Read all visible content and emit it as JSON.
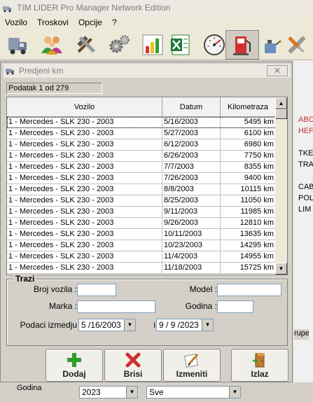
{
  "app": {
    "title": "TIM LIDER Pro Manager Network Edition"
  },
  "menu": [
    "Vozilo",
    "Troskovi",
    "Opcije",
    "?"
  ],
  "toolbar": {
    "icons": [
      "truck-icon",
      "users-icon",
      "tools-icon",
      "gears-icon",
      "bar-chart-icon",
      "excel-icon",
      "speedometer-icon",
      "fuel-icon",
      "oil-can-icon",
      "wrench-screwdriver-icon"
    ]
  },
  "background": {
    "cells": [
      "ABC",
      "HEF",
      "TKE",
      "TRA",
      "CAB",
      "POL",
      "LIM"
    ],
    "grupe_label": "rupe",
    "godina_label": "Godina",
    "godina_value": "2023",
    "sve_value": "Sve"
  },
  "dialog": {
    "title": "Predjeni km",
    "counter": "Podatak 1 od 279",
    "columns": [
      "Vozilo",
      "Datum",
      "Kilometraza"
    ],
    "rows": [
      [
        "1 - Mercedes - SLK 230 - 2003",
        "5/16/2003",
        "5495 km"
      ],
      [
        "1 - Mercedes - SLK 230 - 2003",
        "5/27/2003",
        "6100 km"
      ],
      [
        "1 - Mercedes - SLK 230 - 2003",
        "6/12/2003",
        "6980 km"
      ],
      [
        "1 - Mercedes - SLK 230 - 2003",
        "6/26/2003",
        "7750 km"
      ],
      [
        "1 - Mercedes - SLK 230 - 2003",
        "7/7/2003",
        "8355 km"
      ],
      [
        "1 - Mercedes - SLK 230 - 2003",
        "7/26/2003",
        "9400 km"
      ],
      [
        "1 - Mercedes - SLK 230 - 2003",
        "8/8/2003",
        "10115 km"
      ],
      [
        "1 - Mercedes - SLK 230 - 2003",
        "8/25/2003",
        "11050 km"
      ],
      [
        "1 - Mercedes - SLK 230 - 2003",
        "9/11/2003",
        "11985 km"
      ],
      [
        "1 - Mercedes - SLK 230 - 2003",
        "9/26/2003",
        "12810 km"
      ],
      [
        "1 - Mercedes - SLK 230 - 2003",
        "10/11/2003",
        "13635 km"
      ],
      [
        "1 - Mercedes - SLK 230 - 2003",
        "10/23/2003",
        "14295 km"
      ],
      [
        "1 - Mercedes - SLK 230 - 2003",
        "11/4/2003",
        "14955 km"
      ],
      [
        "1 - Mercedes - SLK 230 - 2003",
        "11/18/2003",
        "15725 km"
      ]
    ],
    "search": {
      "title": "Trazi",
      "broj_vozila_label": "Broj vozila :",
      "broj_vozila_value": "",
      "model_label": "Model :",
      "model_value": "",
      "marka_label": "Marka :",
      "marka_value": "",
      "godina_label": "Godina :",
      "godina_value": "",
      "podaci_label": "Podaci izmedju",
      "date_from": "5 /16/2003",
      "and_label": "i",
      "date_to": "9 / 9 /2023"
    },
    "buttons": {
      "add": "Dodaj",
      "delete": "Brisi",
      "edit": "Izmeniti",
      "exit": "Izlaz"
    }
  }
}
